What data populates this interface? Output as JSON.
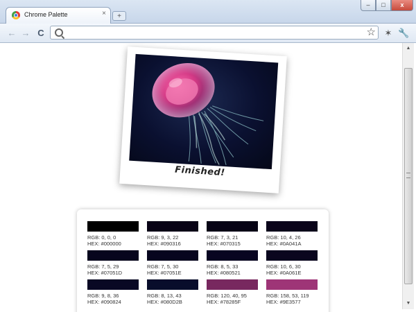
{
  "tab": {
    "title": "Chrome Palette",
    "close_glyph": "×"
  },
  "newtab_glyph": "+",
  "window_buttons": {
    "minimize": "–",
    "maximize": "□",
    "close": "x"
  },
  "nav": {
    "back": "←",
    "forward": "→",
    "reload": "C"
  },
  "omnibox": {
    "value": ""
  },
  "icons": {
    "star": "☆",
    "extension": "✶",
    "wrench": "🔧"
  },
  "polaroid": {
    "caption": "Finished!"
  },
  "swatches": [
    {
      "hex_color": "#000000",
      "rgb": "RGB: 0, 0, 0",
      "hex": "HEX: #000000"
    },
    {
      "hex_color": "#090316",
      "rgb": "RGB: 9, 3, 22",
      "hex": "HEX: #090316"
    },
    {
      "hex_color": "#070315",
      "rgb": "RGB: 7, 3, 21",
      "hex": "HEX: #070315"
    },
    {
      "hex_color": "#0A041A",
      "rgb": "RGB: 10, 4, 26",
      "hex": "HEX: #0A041A"
    },
    {
      "hex_color": "#07051D",
      "rgb": "RGB: 7, 5, 29",
      "hex": "HEX: #07051D"
    },
    {
      "hex_color": "#07051E",
      "rgb": "RGB: 7, 5, 30",
      "hex": "HEX: #07051E"
    },
    {
      "hex_color": "#080521",
      "rgb": "RGB: 8, 5, 33",
      "hex": "HEX: #080521"
    },
    {
      "hex_color": "#0A061E",
      "rgb": "RGB: 10, 6, 30",
      "hex": "HEX: #0A061E"
    },
    {
      "hex_color": "#090824",
      "rgb": "RGB: 9, 8, 36",
      "hex": "HEX: #090824"
    },
    {
      "hex_color": "#080D2B",
      "rgb": "RGB: 8, 13, 43",
      "hex": "HEX: #080D2B"
    },
    {
      "hex_color": "#78285F",
      "rgb": "RGB: 120, 40, 95",
      "hex": "HEX: #78285F"
    },
    {
      "hex_color": "#9E3577",
      "rgb": "RGB: 158, 53, 119",
      "hex": "HEX: #9E3577"
    }
  ]
}
